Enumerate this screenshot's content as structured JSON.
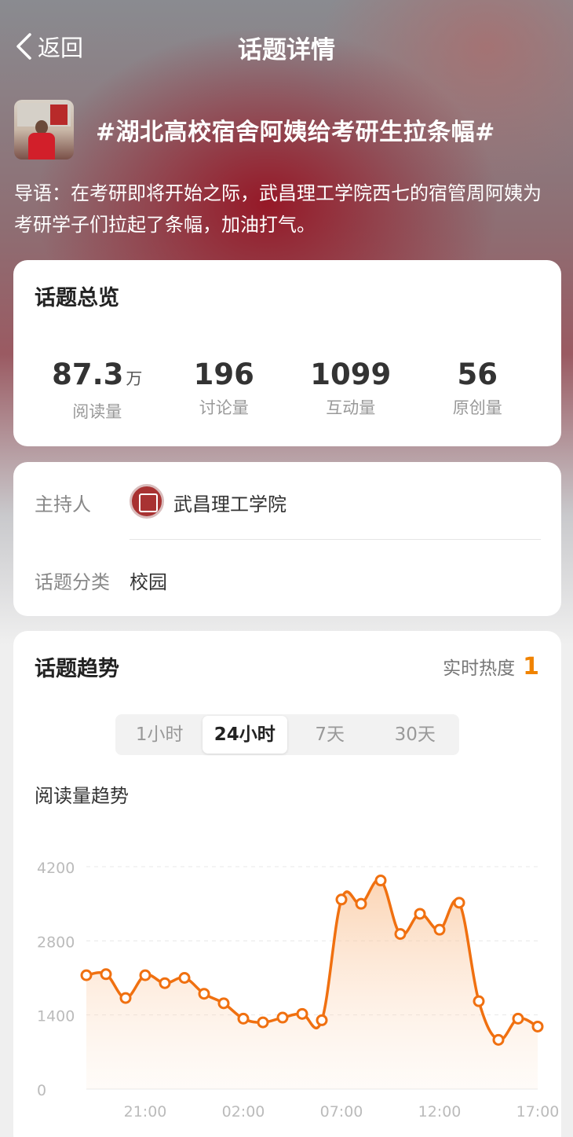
{
  "header": {
    "back_label": "返回",
    "title": "话题详情"
  },
  "topic": {
    "title": "#湖北高校宿舍阿姨给考研生拉条幅#",
    "intro": "导语：在考研即将开始之际，武昌理工学院西七的宿管周阿姨为考研学子们拉起了条幅，加油打气。"
  },
  "overview": {
    "title": "话题总览",
    "stats": [
      {
        "value": "87.3",
        "unit": "万",
        "label": "阅读量"
      },
      {
        "value": "196",
        "unit": "",
        "label": "讨论量"
      },
      {
        "value": "1099",
        "unit": "",
        "label": "互动量"
      },
      {
        "value": "56",
        "unit": "",
        "label": "原创量"
      }
    ]
  },
  "info": {
    "host_label": "主持人",
    "host_name": "武昌理工学院",
    "category_label": "话题分类",
    "category": "校园"
  },
  "trend": {
    "title": "话题趋势",
    "hot_label": "实时热度",
    "hot_value": "1",
    "tabs": [
      "1小时",
      "24小时",
      "7天",
      "30天"
    ],
    "active_tab": 1,
    "chart_title": "阅读量趋势"
  },
  "colors": {
    "accent": "#f08300",
    "line": "#f07010"
  },
  "chart_data": {
    "type": "area",
    "title": "阅读量趋势",
    "yticks": [
      0,
      1400,
      2800,
      4200
    ],
    "ylim": [
      0,
      4200
    ],
    "xticks": [
      "21:00",
      "02:00",
      "07:00",
      "12:00",
      "17:00"
    ],
    "x_tick_index": [
      3,
      8,
      13,
      18,
      23
    ],
    "grid": true,
    "series": [
      {
        "values": [
          2150,
          2170,
          1720,
          2150,
          2000,
          2100,
          1800,
          1620,
          1330,
          1260,
          1350,
          1420,
          1300,
          3580,
          3500,
          3940,
          2930,
          3310,
          3010,
          3520,
          1660,
          930,
          1330,
          1180
        ]
      }
    ]
  }
}
